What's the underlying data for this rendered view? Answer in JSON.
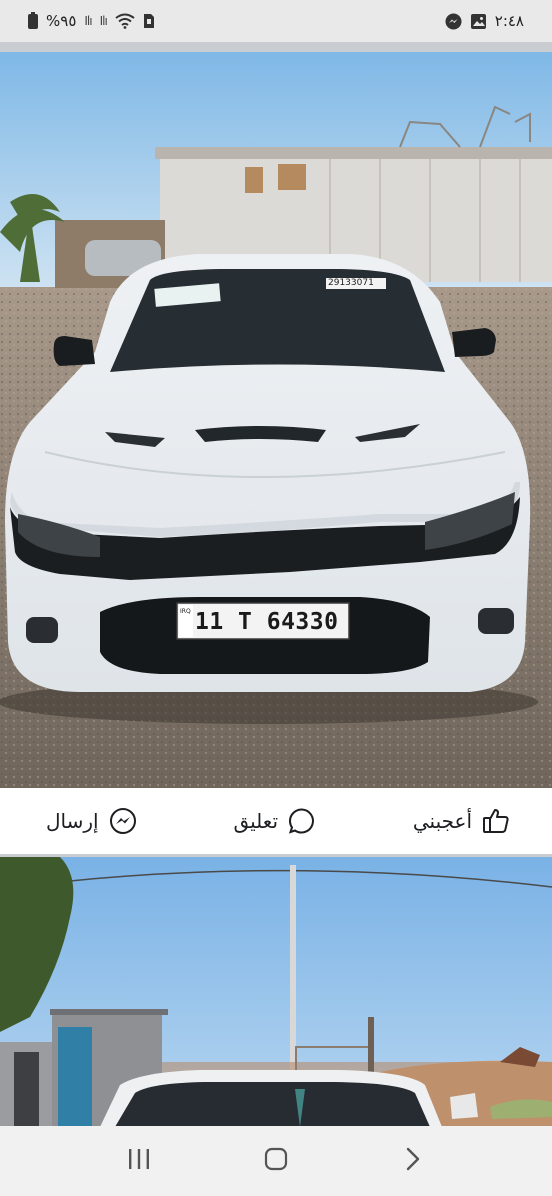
{
  "status_bar": {
    "battery_text": "%٩٥",
    "signal_1": "Ilı",
    "signal_2": "Ilı",
    "time": "٢:٤٨"
  },
  "photo_1": {
    "license_plate": "11 T 64330",
    "plate_country": "IRQ",
    "windshield_sticker": "29133071"
  },
  "actions": {
    "send_label": "إرسال",
    "comment_label": "تعليق",
    "like_label": "أعجبني"
  },
  "colors": {
    "sky": "#8fc3ea",
    "car_white": "#f4f6f8",
    "ground": "#8a7d70",
    "text": "#1c1e21",
    "divider": "#c9ccd1"
  },
  "icons": {
    "send": "messenger-icon",
    "comment": "comment-bubble-icon",
    "like": "thumbs-up-icon",
    "recent_apps": "recent-apps-icon",
    "home": "home-icon",
    "back": "back-chevron-icon"
  }
}
